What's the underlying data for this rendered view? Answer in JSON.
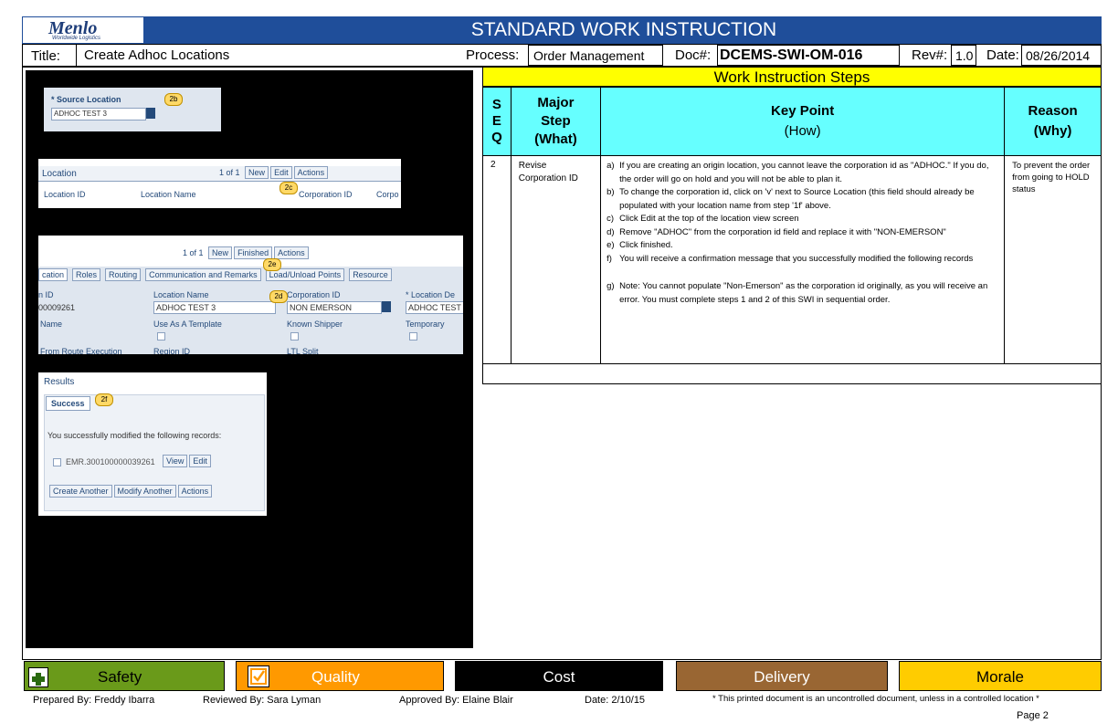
{
  "header": {
    "title": "STANDARD WORK INSTRUCTION",
    "logo_text": "Menlo",
    "logo_subtext": "Worldwide Logistics"
  },
  "info": {
    "title_label": "Title:",
    "title_value": "Create Adhoc Locations",
    "process_label": "Process:",
    "process_value": "Order Management",
    "doc_label": "Doc#:",
    "doc_value": "DCEMS-SWI-OM-016",
    "rev_label": "Rev#:",
    "rev_value": "1.0",
    "date_label": "Date:",
    "date_value": "08/26/2014"
  },
  "steps_title": "Work Instruction Steps",
  "table": {
    "headers": {
      "seq": [
        "S",
        "E",
        "Q"
      ],
      "major": [
        "Major",
        "Step",
        "(What)"
      ],
      "key": [
        "Key Point",
        "(How)"
      ],
      "reason": [
        "Reason",
        "(Why)"
      ]
    },
    "row": {
      "seq": "2",
      "major": "Revise Corporation ID",
      "points": [
        {
          "marker": "a)",
          "text": "If you are creating an origin location, you cannot leave the corporation id as \"ADHOC.\" If you do, the order will go on hold and you will not be able to plan it."
        },
        {
          "marker": "b)",
          "text": "To change the corporation id, click on 'v' next to Source Location (this field should already be populated with your location name from step '1f' above."
        },
        {
          "marker": "c)",
          "text": "Click Edit at the top of the location view screen"
        },
        {
          "marker": "d)",
          "text": "Remove \"ADHOC\" from the corporation id field and replace it with \"NON-EMERSON\""
        },
        {
          "marker": "e)",
          "text": "Click finished."
        },
        {
          "marker": "f)",
          "text": "You will receive a confirmation message that you successfully modified the following records"
        },
        {
          "marker": "g)",
          "text": "Note: You cannot populate \"Non-Emerson\" as the corporation id originally, as you will receive an error. You must complete steps 1 and 2 of this SWI in sequential order."
        }
      ],
      "reason": "To prevent the order from going to HOLD status"
    }
  },
  "screenshots": {
    "shot1": {
      "badge": "2b",
      "field_label": "* Source Location",
      "field_value": "ADHOC TEST 3"
    },
    "shot2": {
      "badge": "2c",
      "heading": "Location",
      "pager": "1 of 1",
      "buttons": [
        "New",
        "Edit",
        "Actions"
      ],
      "columns": [
        "Location ID",
        "Location Name",
        "Corporation ID",
        "Corpo"
      ]
    },
    "shot3": {
      "badge_e": "2e",
      "badge_d": "2d",
      "pager": "1 of 1",
      "buttons": [
        "New",
        "Finished",
        "Actions"
      ],
      "tabs": [
        "cation",
        "Roles",
        "Routing",
        "Communication and Remarks",
        "Load/Unload Points",
        "Resource"
      ],
      "labels": [
        "n ID",
        "Location Name",
        "Corporation ID",
        "* Location De",
        "Name",
        "Use As A Template",
        "Known Shipper",
        "Temporary",
        "From Route Execution",
        "Region ID",
        "LTL Split"
      ],
      "values": [
        "00009261",
        "ADHOC TEST 3",
        "NON EMERSON",
        "ADHOC TEST"
      ]
    },
    "shot4": {
      "badge": "2f",
      "heading": "Results",
      "tab": "Success",
      "message": "You successfully modified the following records:",
      "record": "EMR.300100000039261",
      "row_buttons": [
        "View",
        "Edit"
      ],
      "bottom_buttons": [
        "Create Another",
        "Modify Another",
        "Actions"
      ]
    }
  },
  "footer": {
    "categories": [
      {
        "label": "Safety",
        "color": "#6a9a1a"
      },
      {
        "label": "Quality",
        "color": "#ff9900"
      },
      {
        "label": "Cost",
        "color": "#000000"
      },
      {
        "label": "Delivery",
        "color": "#996633"
      },
      {
        "label": "Morale",
        "color": "#ffcc00"
      }
    ],
    "prepared": "Prepared By:  Freddy Ibarra",
    "reviewed": "Reviewed By:  Sara Lyman",
    "approved": "Approved By: Elaine Blair",
    "date": "Date: 2/10/15",
    "disclaimer": "* This printed document is an uncontrolled document, unless in a controlled location *",
    "page": "Page 2"
  }
}
